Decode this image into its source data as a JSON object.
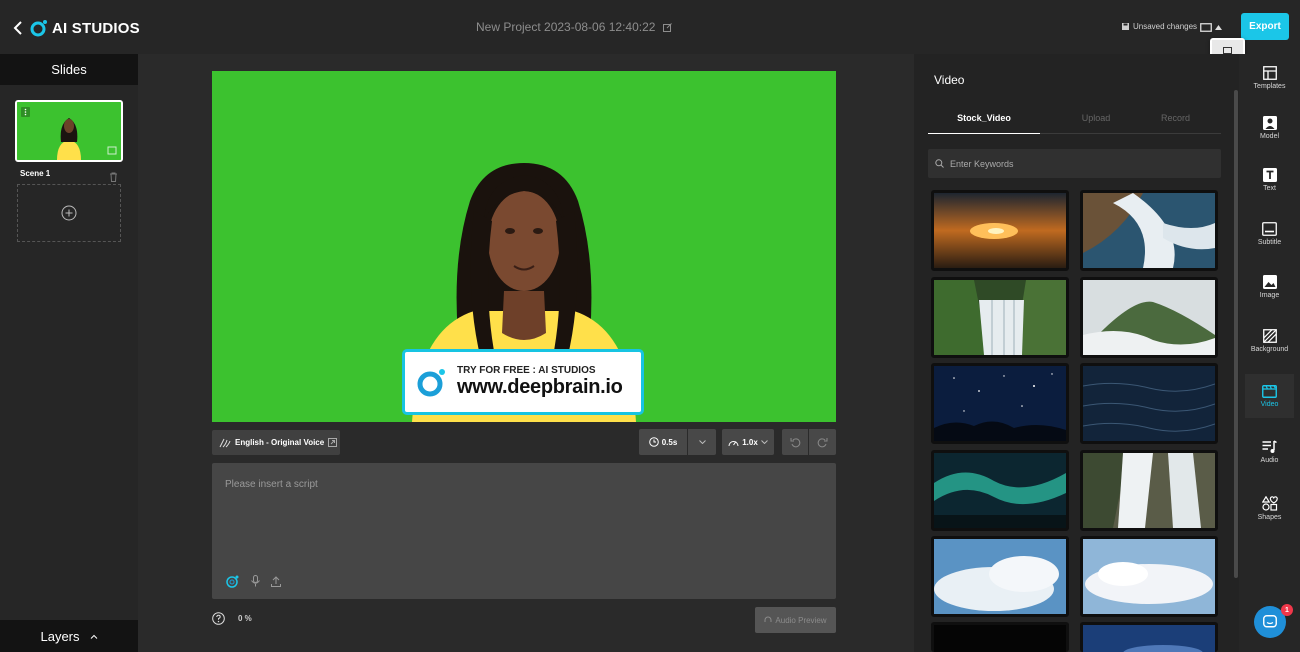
{
  "header": {
    "brand": "AI STUDIOS",
    "project_title": "New Project 2023-08-06 12:40:22",
    "unsaved_label": "Unsaved changes",
    "export_label": "Export"
  },
  "slides": {
    "title": "Slides",
    "scenes": [
      {
        "label": "Scene 1"
      }
    ],
    "layers_label": "Layers"
  },
  "watermark": {
    "tagline": "TRY FOR FREE : AI STUDIOS",
    "url": "www.deepbrain.io"
  },
  "controls": {
    "voice_label": "English - Original Voice",
    "pause_value": "0.5s",
    "speed_value": "1.0x"
  },
  "script": {
    "placeholder": "Please insert a script",
    "progress": "0 %",
    "audio_preview_label": "Audio Preview"
  },
  "video_panel": {
    "title": "Video",
    "tabs": [
      {
        "label": "Stock_Video",
        "active": true
      },
      {
        "label": "Upload",
        "active": false
      },
      {
        "label": "Record",
        "active": false
      }
    ],
    "search_placeholder": "Enter Keywords"
  },
  "tool_rail": [
    {
      "label": "Templates",
      "icon": "templates-icon"
    },
    {
      "label": "Model",
      "icon": "model-icon"
    },
    {
      "label": "Text",
      "icon": "text-icon"
    },
    {
      "label": "Subtitle",
      "icon": "subtitle-icon"
    },
    {
      "label": "Image",
      "icon": "image-icon"
    },
    {
      "label": "Background",
      "icon": "background-icon"
    },
    {
      "label": "Video",
      "icon": "video-icon",
      "active": true
    },
    {
      "label": "Audio",
      "icon": "audio-icon"
    },
    {
      "label": "Shapes",
      "icon": "shapes-icon"
    }
  ],
  "chat": {
    "badge_count": "1"
  },
  "colors": {
    "accent": "#1bc6e8",
    "chroma_green": "#3cc22f",
    "badge": "#f0374a"
  }
}
